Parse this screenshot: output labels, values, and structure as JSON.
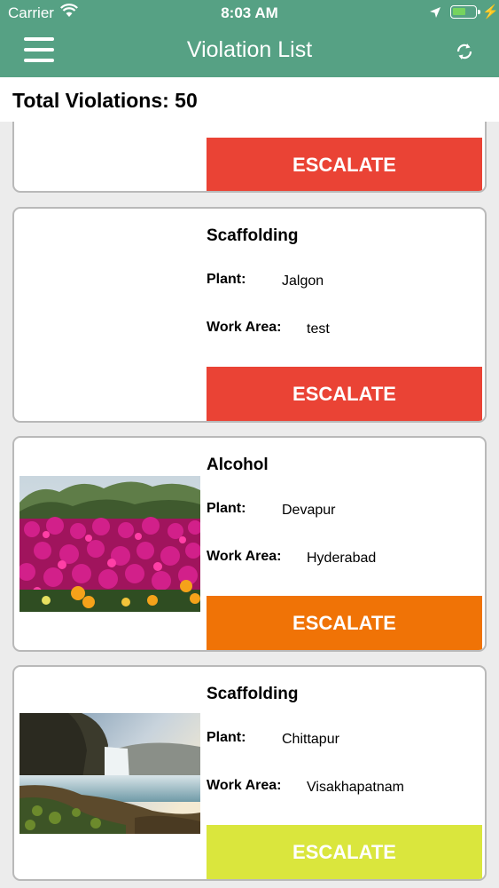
{
  "status_bar": {
    "carrier": "Carrier",
    "time": "8:03 AM"
  },
  "nav": {
    "title": "Violation List",
    "menu_icon": "hamburger-menu-icon",
    "refresh_icon": "refresh-icon"
  },
  "summary": {
    "total_text": "Total Violations: 50"
  },
  "labels": {
    "plant": "Plant:",
    "work_area": "Work Area:",
    "escalate": "ESCALATE"
  },
  "colors": {
    "header": "#56a184",
    "escalate_red": "#ea4335",
    "escalate_orange": "#f07306",
    "escalate_yellow": "#dae63d"
  },
  "violations": [
    {
      "type": "",
      "plant": "",
      "work_area": "",
      "image": "none",
      "escalate_color": "#ea4335"
    },
    {
      "type": "Scaffolding",
      "plant": "Jalgon",
      "work_area": "test",
      "image": "none",
      "escalate_color": "#ea4335"
    },
    {
      "type": "Alcohol",
      "plant": "Devapur",
      "work_area": "Hyderabad",
      "image": "flowers-photo",
      "escalate_color": "#f07306"
    },
    {
      "type": "Scaffolding",
      "plant": "Chittapur",
      "work_area": "Visakhapatnam",
      "image": "waterfall-photo",
      "escalate_color": "#dae63d"
    }
  ]
}
